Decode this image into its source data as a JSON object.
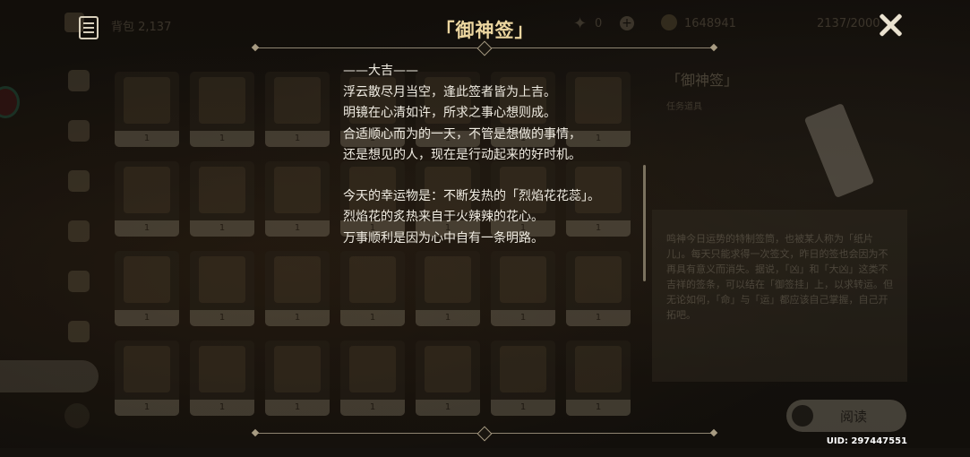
{
  "background_inventory": {
    "bag_title": "背包 2,137",
    "resource_zero": "0",
    "mora": "1648941",
    "capacity": "2137/2000",
    "grid_counts": [
      "1",
      "1",
      "1",
      "1",
      "1",
      "1",
      "1",
      "1",
      "1",
      "1",
      "1",
      "1",
      "1",
      "1",
      "1",
      "1",
      "1",
      "1",
      "1",
      "1",
      "1",
      "1",
      "1",
      "1",
      "1",
      "1",
      "1",
      "1"
    ],
    "detail_name": "「御神签」",
    "detail_type": "任务道具",
    "detail_description": "鸣神今日运势的特制签筒，也被某人称为「纸片儿」。每天只能求得一次签文，昨日的签也会因为不再具有意义而消失。据说，「凶」和「大凶」这类不吉祥的签条，可以结在「御签挂」上，以求转运。但无论如何，「命」与「运」都应该自己掌握，自己开拓吧。",
    "read_button": "阅读"
  },
  "overlay": {
    "title": "「御神签」",
    "fortune_lines": [
      "——大吉——",
      "浮云散尽月当空，逢此签者皆为上吉。",
      "明镜在心清如许，所求之事心想则成。",
      "合适顺心而为的一天，不管是想做的事情，",
      "还是想见的人，现在是行动起来的好时机。"
    ],
    "fortune_lines_2": [
      "今天的幸运物是：不断发热的「烈焰花花蕊」。",
      "烈焰花的炙热来自于火辣辣的花心。",
      "万事顺利是因为心中自有一条明路。"
    ]
  },
  "uid": "UID: 297447551",
  "colors": {
    "title_gold": "#ecd6a0",
    "text": "#f0ece2",
    "background": "#15120e"
  },
  "icons": [
    "bookmark-icon",
    "close-icon",
    "trash-icon",
    "primogem-icon",
    "mora-icon"
  ]
}
